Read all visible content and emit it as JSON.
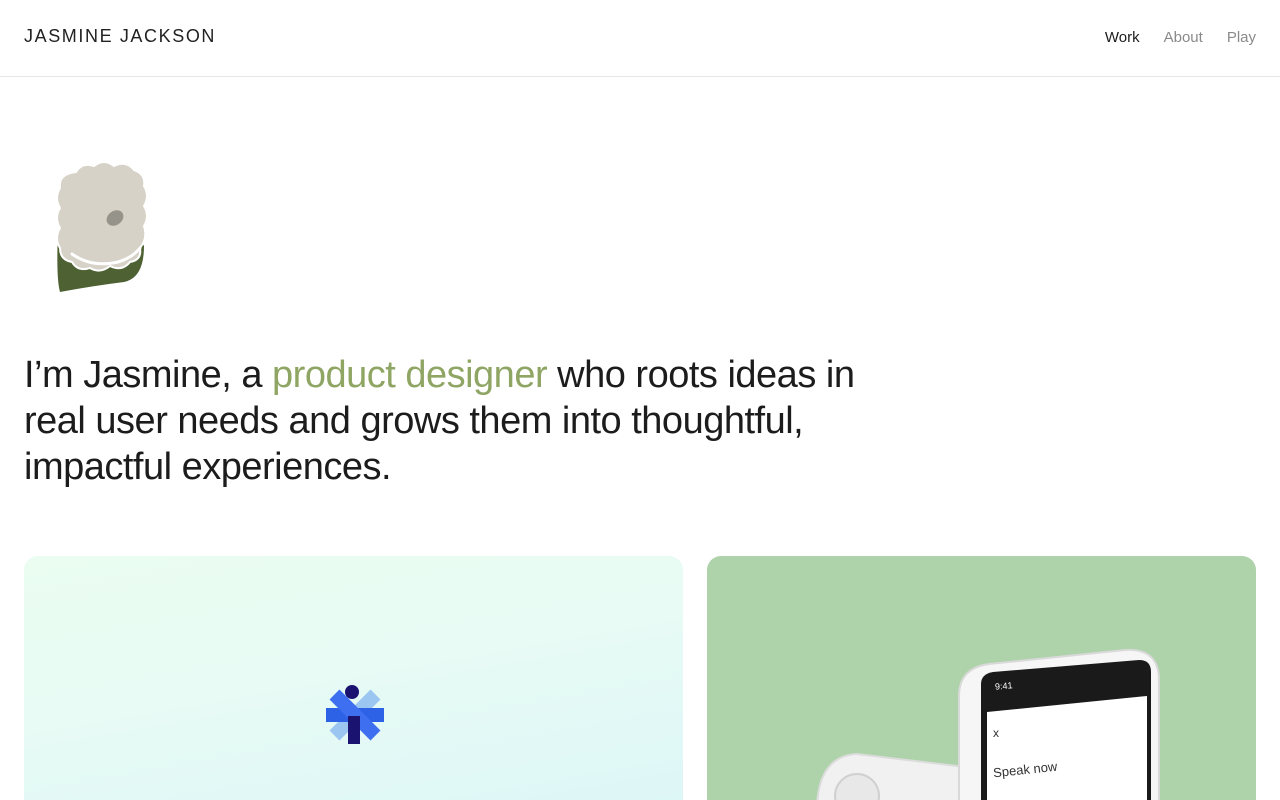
{
  "header": {
    "brand": "JASMINE JACKSON",
    "nav": [
      {
        "label": "Work",
        "active": true
      },
      {
        "label": "About",
        "active": false
      },
      {
        "label": "Play",
        "active": false
      }
    ]
  },
  "hero": {
    "intro_before": "I’m Jasmine, a ",
    "intro_accent": "product designer",
    "intro_after": " who roots ideas in real user needs and grows them into thoughtful, impactful experiences."
  },
  "cards": {
    "right": {
      "status_time": "9:41",
      "close_label": "x",
      "prompt_text": "Speak now"
    }
  },
  "colors": {
    "accent": "#8fa564",
    "card_green": "#aed2aa",
    "flower_petal": "#d6d2c7",
    "flower_leaf": "#4d6132"
  },
  "icons": [
    "flower-illustration",
    "asterisk-logo-icon"
  ]
}
